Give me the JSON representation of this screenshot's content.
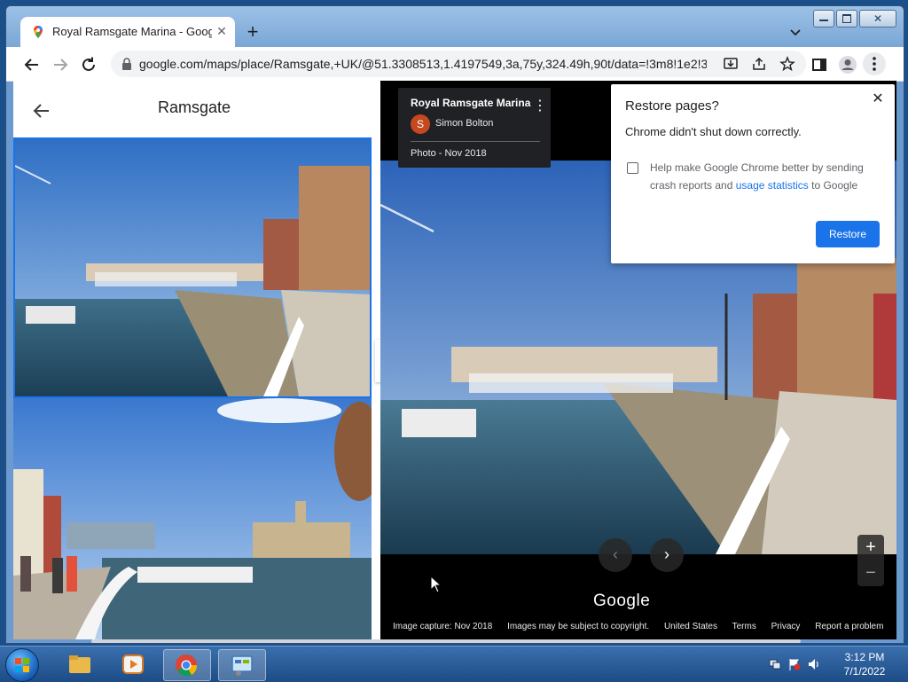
{
  "browser": {
    "tab_title": "Royal Ramsgate Marina - Google",
    "url": "google.com/maps/place/Ramsgate,+UK/@51.3308513,1.4197549,3a,75y,324.49h,90t/data=!3m8!1e2!3..."
  },
  "panel": {
    "title": "Ramsgate"
  },
  "photo": {
    "place": "Royal Ramsgate Marina",
    "author_initial": "S",
    "author": "Simon Bolton",
    "date_label": "Photo - Nov 2018"
  },
  "viewer": {
    "logo": "Google",
    "zoom_in": "+",
    "zoom_out": "−",
    "footer": {
      "capture": "Image capture: Nov 2018",
      "copyright": "Images may be subject to copyright.",
      "country": "United States",
      "terms": "Terms",
      "privacy": "Privacy",
      "report": "Report a problem"
    }
  },
  "dialog": {
    "title": "Restore pages?",
    "message": "Chrome didn't shut down correctly.",
    "checkbox_text": "Help make Google Chrome better by sending crash reports and",
    "link_text": "usage statistics",
    "checkbox_tail": "to Google",
    "button": "Restore"
  },
  "taskbar": {
    "time": "3:12 PM",
    "date": "7/1/2022"
  },
  "colors": {
    "accent": "#1a73e8",
    "taskbar": "#1d4c86"
  }
}
